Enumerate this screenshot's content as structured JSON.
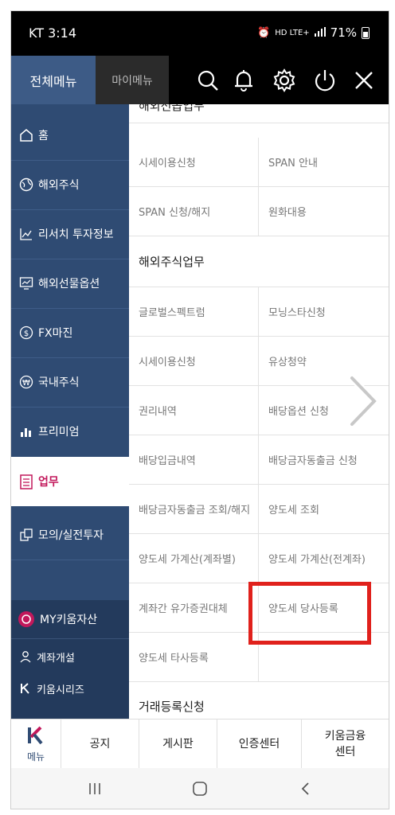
{
  "status_bar": {
    "carrier_time": "KT 3:14",
    "signal_text": "HD LTE+",
    "battery": "71%"
  },
  "topbar": {
    "tab_all": "전체메뉴",
    "tab_my": "마이메뉴",
    "icons": [
      "search-icon",
      "bell-icon",
      "gear-icon",
      "power-icon",
      "close-icon"
    ]
  },
  "nav": {
    "items": [
      {
        "label": "홈",
        "icon": "home-icon"
      },
      {
        "label": "해외주식",
        "icon": "globe-icon"
      },
      {
        "label": "리서치 투자정보",
        "icon": "chart-line-icon"
      },
      {
        "label": "해외선물옵션",
        "icon": "monitor-chart-icon"
      },
      {
        "label": "FX마진",
        "icon": "dollar-icon"
      },
      {
        "label": "국내주식",
        "icon": "won-icon"
      },
      {
        "label": "프리미엄",
        "icon": "bar-chart-icon"
      },
      {
        "label": "업무",
        "icon": "checklist-icon",
        "selected": true
      },
      {
        "label": "모의/실전투자",
        "icon": "mock-invest-icon"
      }
    ],
    "my_asset": "MY키움자산",
    "account_open": "계좌개설",
    "kiwoom_series": "키움시리즈"
  },
  "content": {
    "section_top_partial": "해외선옵업무",
    "rows_a": [
      [
        "시세이용신청",
        "SPAN 안내"
      ],
      [
        "SPAN 신청/해지",
        "원화대용"
      ]
    ],
    "section_2": "해외주식업무",
    "rows_b": [
      [
        "글로벌스펙트럼",
        "모닝스타신청"
      ],
      [
        "시세이용신청",
        "유상청약"
      ],
      [
        "권리내역",
        "배당옵션 신청"
      ],
      [
        "배당입금내역",
        "배당금자동출금 신청"
      ],
      [
        "배당금자동출금 조회/해지",
        "양도세 조회"
      ],
      [
        "양도세 가계산(계좌별)",
        "양도세 가계산(전계좌)"
      ],
      [
        "계좌간 유가증권대체",
        "양도세 당사등록"
      ],
      [
        "양도세 타사등록",
        ""
      ]
    ],
    "section_3": "거래등록신청"
  },
  "bottom": {
    "menu_label": "메뉴",
    "tabs": [
      "공지",
      "게시판",
      "인증센터",
      "키움금융\n센터"
    ]
  },
  "colors": {
    "nav_bg": "#2f4b73",
    "accent": "#c2185b",
    "highlight": "#e0211c"
  }
}
